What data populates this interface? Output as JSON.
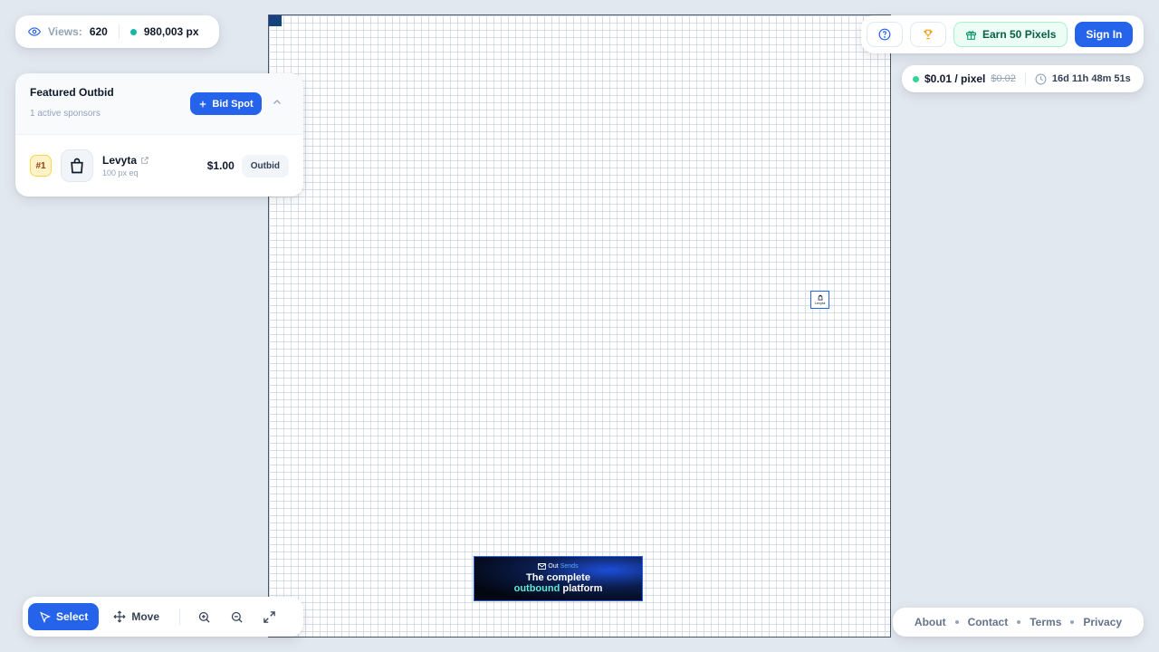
{
  "stats": {
    "views_label": "Views:",
    "views_value": "620",
    "pixels_value": "980,003 px",
    "dot_color": "#14b8a6"
  },
  "featured": {
    "title": "Featured Outbid",
    "subtitle": "1 active sponsors",
    "bid_label": "Bid Spot",
    "sponsors": [
      {
        "rank": "#1",
        "name": "Levyta",
        "equiv": "100 px eq",
        "price": "$1.00",
        "status": "Outbid"
      }
    ]
  },
  "topbar": {
    "earn_label": "Earn 50 Pixels",
    "signin_label": "Sign In"
  },
  "pricing": {
    "current": "$0.01 / pixel",
    "old": "$0.02",
    "timer": "16d 11h 48m 51s",
    "dot_color": "#34d399"
  },
  "canvas": {
    "pixel_label": "Levyta",
    "banner": {
      "brand_a": "Out",
      "brand_b": "Sends",
      "line1": "The complete",
      "line2_hl": "outbound",
      "line2_rest": " platform"
    }
  },
  "toolbar": {
    "select_label": "Select",
    "move_label": "Move"
  },
  "footer": {
    "about": "About",
    "contact": "Contact",
    "terms": "Terms",
    "privacy": "Privacy"
  },
  "colors": {
    "accent": "#2563eb",
    "earn": "#065f46"
  }
}
